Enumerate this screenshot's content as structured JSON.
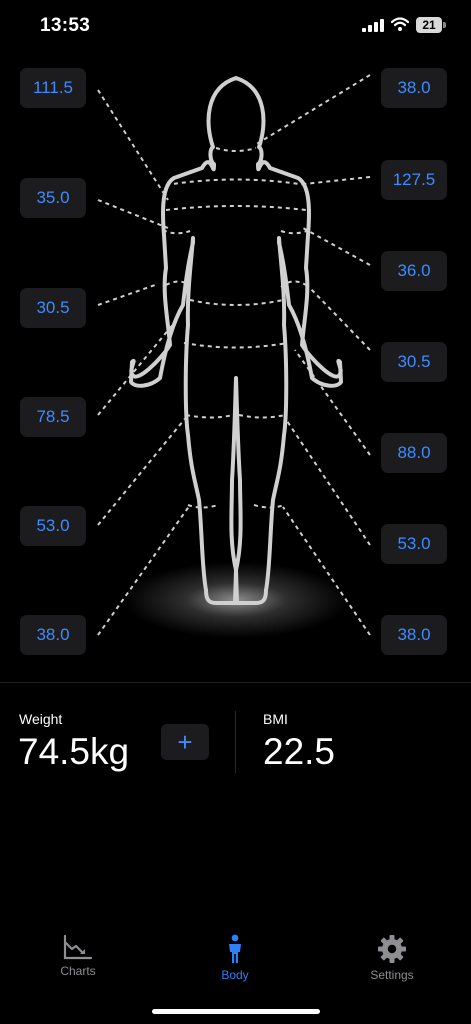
{
  "status": {
    "time": "13:53",
    "battery": "21"
  },
  "measurements": {
    "left": [
      "111.5",
      "35.0",
      "30.5",
      "78.5",
      "53.0",
      "38.0"
    ],
    "right": [
      "38.0",
      "127.5",
      "36.0",
      "30.5",
      "88.0",
      "53.0",
      "38.0"
    ]
  },
  "summary": {
    "weight_label": "Weight",
    "weight_value": "74.5kg",
    "add_label": "+",
    "bmi_label": "BMI",
    "bmi_value": "22.5"
  },
  "tabs": [
    {
      "label": "Charts",
      "icon": "chart-icon",
      "active": false
    },
    {
      "label": "Body",
      "icon": "person-icon",
      "active": true
    },
    {
      "label": "Settings",
      "icon": "gear-icon",
      "active": false
    }
  ],
  "colors": {
    "accent": "#2f7ff5",
    "value_text": "#3d8bff",
    "inactive": "#8e8e93",
    "chip_bg": "#1c1c1e",
    "background": "#000000"
  }
}
